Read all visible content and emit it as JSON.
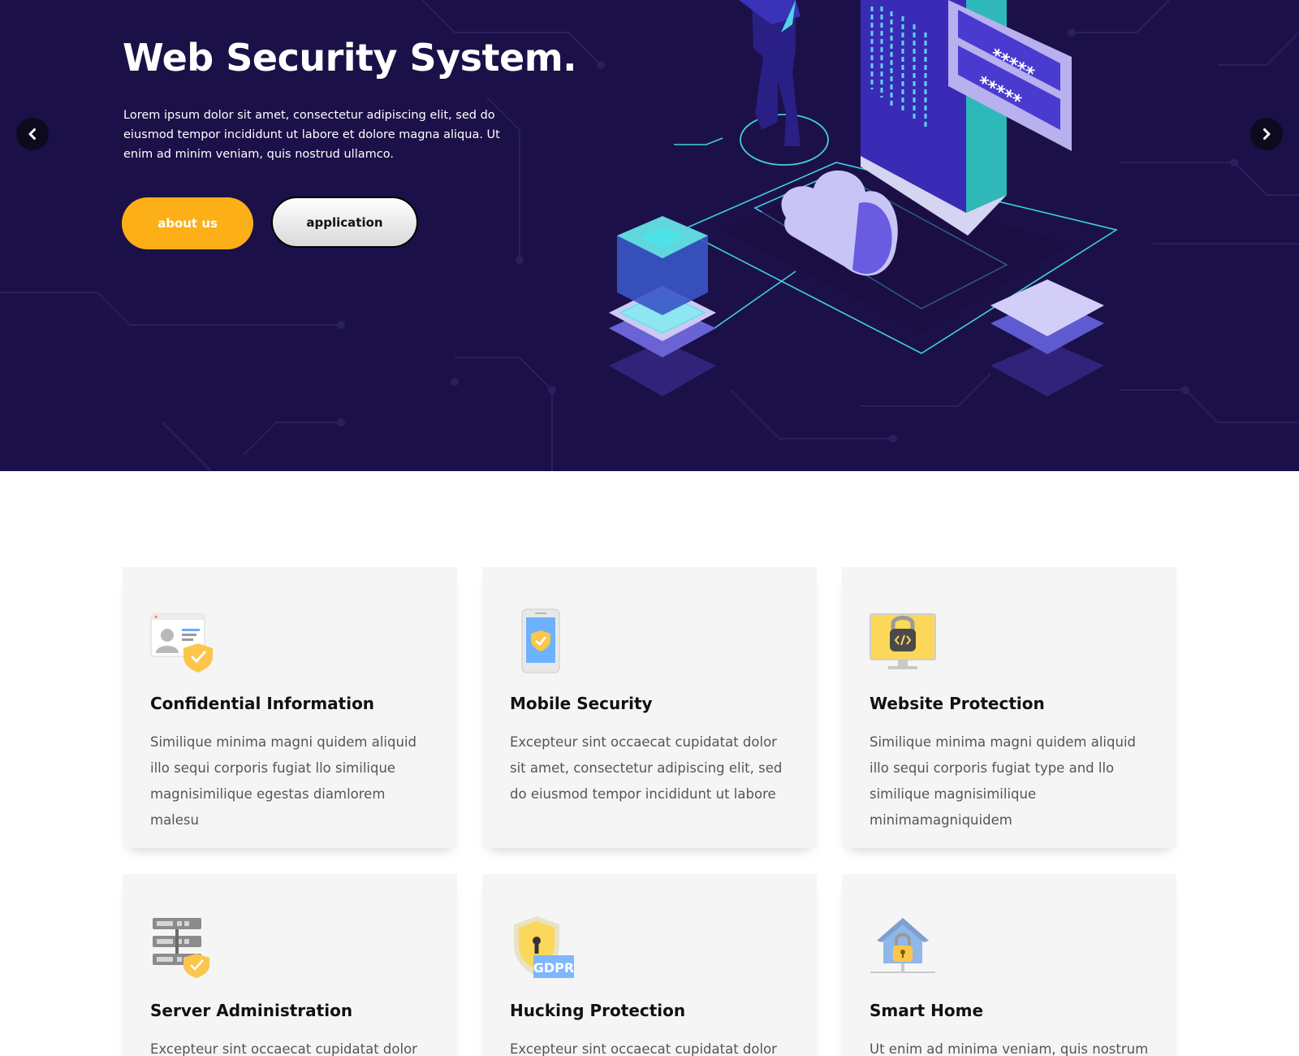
{
  "hero": {
    "title": "Web Security System.",
    "text": "Lorem ipsum dolor sit amet, consectetur adipiscing elit, sed do eiusmod tempor incididunt ut labore et dolore magna aliqua. Ut enim ad minim veniam, quis nostrud ullamco.",
    "primary_button": "about us",
    "secondary_button": "application",
    "prev_icon": "chevron-left-icon",
    "next_icon": "chevron-right-icon",
    "colors": {
      "background": "#1c1048",
      "accent": "#fcaf17",
      "circuit": "#2a1f5e",
      "cyan": "#4fe3e8"
    }
  },
  "services": [
    {
      "icon": "id-card-shield-icon",
      "title": "Confidential Information",
      "text": "Similique minima magni quidem aliquid illo sequi corporis fugiat llo similique magnisimilique egestas diamlorem malesu"
    },
    {
      "icon": "mobile-shield-icon",
      "title": "Mobile Security",
      "text": "Excepteur sint occaecat cupidatat dolor sit amet, consectetur adipiscing elit, sed do eiusmod tempor incididunt ut labore"
    },
    {
      "icon": "monitor-lock-icon",
      "title": "Website Protection",
      "text": "Similique minima magni quidem aliquid illo sequi corporis fugiat type and llo similique magnisimilique minimamagniquidem"
    },
    {
      "icon": "server-shield-icon",
      "title": "Server Administration",
      "text": "Excepteur sint occaecat cupidatat dolor sit"
    },
    {
      "icon": "gdpr-shield-icon",
      "title": "Hucking Protection",
      "text": "Excepteur sint occaecat cupidatat dolor sit"
    },
    {
      "icon": "house-lock-icon",
      "title": "Smart Home",
      "text": "Ut enim ad minima veniam, quis nostrum"
    }
  ]
}
